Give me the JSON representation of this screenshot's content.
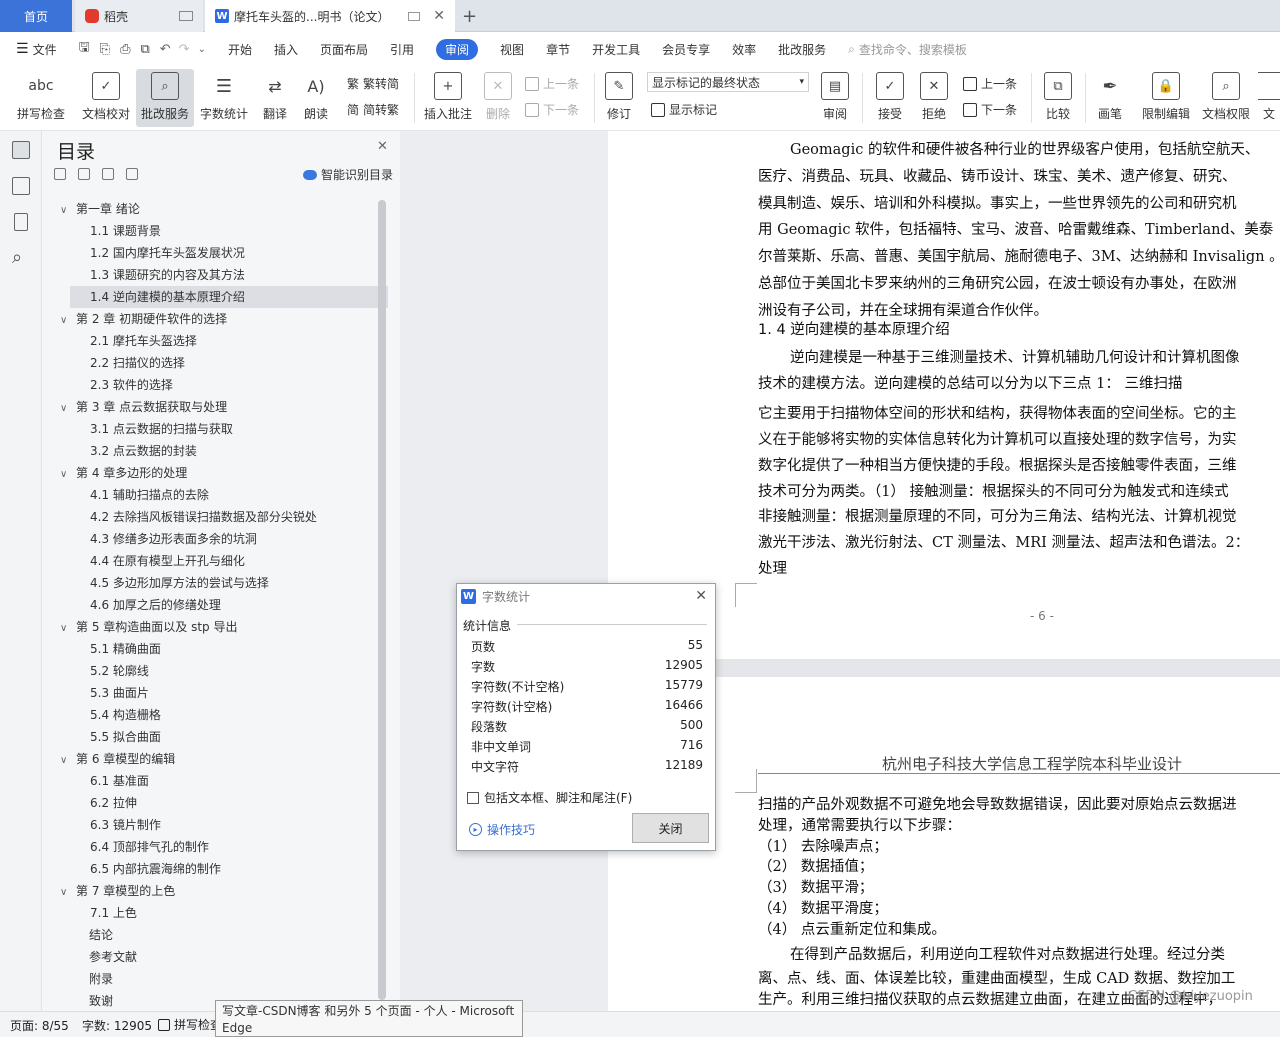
{
  "tabs": {
    "home": "首页",
    "daoke": "稻壳",
    "doc": "摩托车头盔的...明书（论文）",
    "new": "+"
  },
  "menu": [
    "文件",
    "开始",
    "插入",
    "页面布局",
    "引用",
    "审阅",
    "视图",
    "章节",
    "开发工具",
    "会员专享",
    "效率",
    "批改服务"
  ],
  "menu_active": "审阅",
  "search_placeholder": "查找命令、搜索模板",
  "ribbon": {
    "spellcheck": "拼写检查",
    "doc_proof": "文档校对",
    "correction": "批改服务",
    "wordcount": "字数统计",
    "translate": "翻译",
    "read": "朗读",
    "trad": "繁转简",
    "simp": "简转繁",
    "insert_comment": "插入批注",
    "delete": "删除",
    "prev1": "上一条",
    "next1": "下一条",
    "track": "修订",
    "markup_dropdown": "显示标记的最终状态",
    "show_markup": "显示标记",
    "review": "审阅",
    "accept": "接受",
    "reject": "拒绝",
    "prev2": "上一条",
    "next2": "下一条",
    "compare": "比较",
    "ink": "画笔",
    "restrict": "限制编辑",
    "permission": "文档权限",
    "more": "文"
  },
  "toc": {
    "title": "目录",
    "smart": "智能识别目录",
    "items": [
      {
        "label": "第一章  绪论",
        "level": 1
      },
      {
        "label": "1.1 课题背景",
        "level": 2
      },
      {
        "label": "1.2 国内摩托车头盔发展状况",
        "level": 2
      },
      {
        "label": "1.3 课题研究的内容及其方法",
        "level": 2
      },
      {
        "label": "1.4 逆向建模的基本原理介绍",
        "level": 2,
        "selected": true
      },
      {
        "label": "第 2 章  初期硬件软件的选择",
        "level": 1
      },
      {
        "label": "2.1 摩托车头盔选择",
        "level": 2
      },
      {
        "label": "2.2 扫描仪的选择",
        "level": 2
      },
      {
        "label": "2.3  软件的选择",
        "level": 2
      },
      {
        "label": "第 3 章    点云数据获取与处理",
        "level": 1
      },
      {
        "label": "3.1  点云数据的扫描与获取",
        "level": 2
      },
      {
        "label": "3.2  点云数据的封装",
        "level": 2
      },
      {
        "label": "第 4 章多边形的处理",
        "level": 1
      },
      {
        "label": "4.1  辅助扫描点的去除",
        "level": 2
      },
      {
        "label": "4.2  去除挡风板错误扫描数据及部分尖锐处",
        "level": 2
      },
      {
        "label": "4.3  修缮多边形表面多余的坑洞",
        "level": 2
      },
      {
        "label": "4.4  在原有模型上开孔与细化",
        "level": 2
      },
      {
        "label": "4.5  多边形加厚方法的尝试与选择",
        "level": 2
      },
      {
        "label": "4.6  加厚之后的修缮处理",
        "level": 2
      },
      {
        "label": "第 5 章构造曲面以及 stp 导出",
        "level": 1
      },
      {
        "label": "5.1  精确曲面",
        "level": 2
      },
      {
        "label": "5.2  轮廓线",
        "level": 2
      },
      {
        "label": "5.3  曲面片",
        "level": 2
      },
      {
        "label": "5.4  构造栅格",
        "level": 2
      },
      {
        "label": "5.5  拟合曲面",
        "level": 2
      },
      {
        "label": "第 6 章模型的编辑",
        "level": 1
      },
      {
        "label": "6.1  基准面",
        "level": 2
      },
      {
        "label": "6.2  拉伸",
        "level": 2
      },
      {
        "label": "6.3  镜片制作",
        "level": 2
      },
      {
        "label": "6.4  顶部排气孔的制作",
        "level": 2
      },
      {
        "label": "6.5  内部抗震海绵的制作",
        "level": 2
      },
      {
        "label": "第 7 章模型的上色",
        "level": 1
      },
      {
        "label": "7.1  上色",
        "level": 2
      },
      {
        "label": "结论",
        "level": 0
      },
      {
        "label": "参考文献",
        "level": 0
      },
      {
        "label": "附录",
        "level": 0
      },
      {
        "label": "致谢",
        "level": 0
      }
    ]
  },
  "page1": {
    "lines": [
      "Geomagic 的软件和硬件被各种行业的世界级客户使用，包括航空航天、",
      "医疗、消费品、玩具、收藏品、铸币设计、珠宝、美术、遗产修复、研究、",
      "模具制造、娱乐、培训和外科模拟。事实上，一些世界领先的公司和研究机",
      "用 Geomagic 软件，包括福特、宝马、波音、哈雷戴维森、Timberland、美泰",
      "尔普莱斯、乐高、普惠、美国宇航局、施耐德电子、3M、达纳赫和 Invisalign 。Ge",
      "总部位于美国北卡罗来纳州的三角研究公园，在波士顿设有办事处，在欧洲",
      "洲设有子公司，并在全球拥有渠道合作伙伴。"
    ],
    "heading": "1. 4 逆向建模的基本原理介绍",
    "lines2": [
      "逆向建模是一种基于三维测量技术、计算机辅助几何设计和计算机图像",
      "技术的建模方法。逆向建模的总结可以分为以下三点 1：  三维扫描",
      "它主要用于扫描物体空间的形状和结构，获得物体表面的空间坐标。它的主",
      "义在于能够将实物的实体信息转化为计算机可以直接处理的数字信号，为实",
      "数字化提供了一种相当方便快捷的手段。根据探头是否接触零件表面，三维",
      "技术可分为两类。（1）  接触测量：根据探头的不同可分为触发式和连续式",
      "非接触测量：根据测量原理的不同，可分为三角法、结构光法、计算机视觉",
      "激光干涉法、激光衍射法、CT 测量法、MRI 测量法、超声法和色谱法。2：",
      "处理"
    ],
    "page_num": "- 6 -"
  },
  "page2": {
    "header": "杭州电子科技大学信息工程学院本科毕业设计",
    "lines": [
      "扫描的产品外观数据不可避免地会导致数据错误，因此要对原始点云数据进",
      "处理，通常需要执行以下步骤：",
      "（1）  去除噪声点；",
      "（2）  数据插值；",
      "（3）  数据平滑；",
      "（4）  数据平滑度；",
      "（4）  点云重新定位和集成。",
      "在得到产品数据后，利用逆向工程软件对点数据进行处理。经过分类",
      "离、点、线、面、体误差比较，重建曲面模型，生成 CAD 数据、数控加工",
      "生产。利用三维扫描仪获取的点云数据建立曲面，在建立曲面的过程中，"
    ]
  },
  "dialog": {
    "title": "字数统计",
    "section": "统计信息",
    "rows": [
      {
        "label": "页数",
        "value": "55"
      },
      {
        "label": "字数",
        "value": "12905"
      },
      {
        "label": "字符数(不计空格)",
        "value": "15779"
      },
      {
        "label": "字符数(计空格)",
        "value": "16466"
      },
      {
        "label": "段落数",
        "value": "500"
      },
      {
        "label": "非中文单词",
        "value": "716"
      },
      {
        "label": "中文字符",
        "value": "12189"
      }
    ],
    "checkbox": "包括文本框、脚注和尾注(F)",
    "tips": "操作技巧",
    "close": "关闭"
  },
  "status": {
    "page": "页面: 8/55",
    "words": "字数: 12905",
    "spell": "拼写检查"
  },
  "tooltip": {
    "line1": "写文章-CSDN博客 和另外 5 个页面 - 个人 - Microsoft",
    "line2": "Edge"
  },
  "watermark": "CSDN @biyezuopin"
}
